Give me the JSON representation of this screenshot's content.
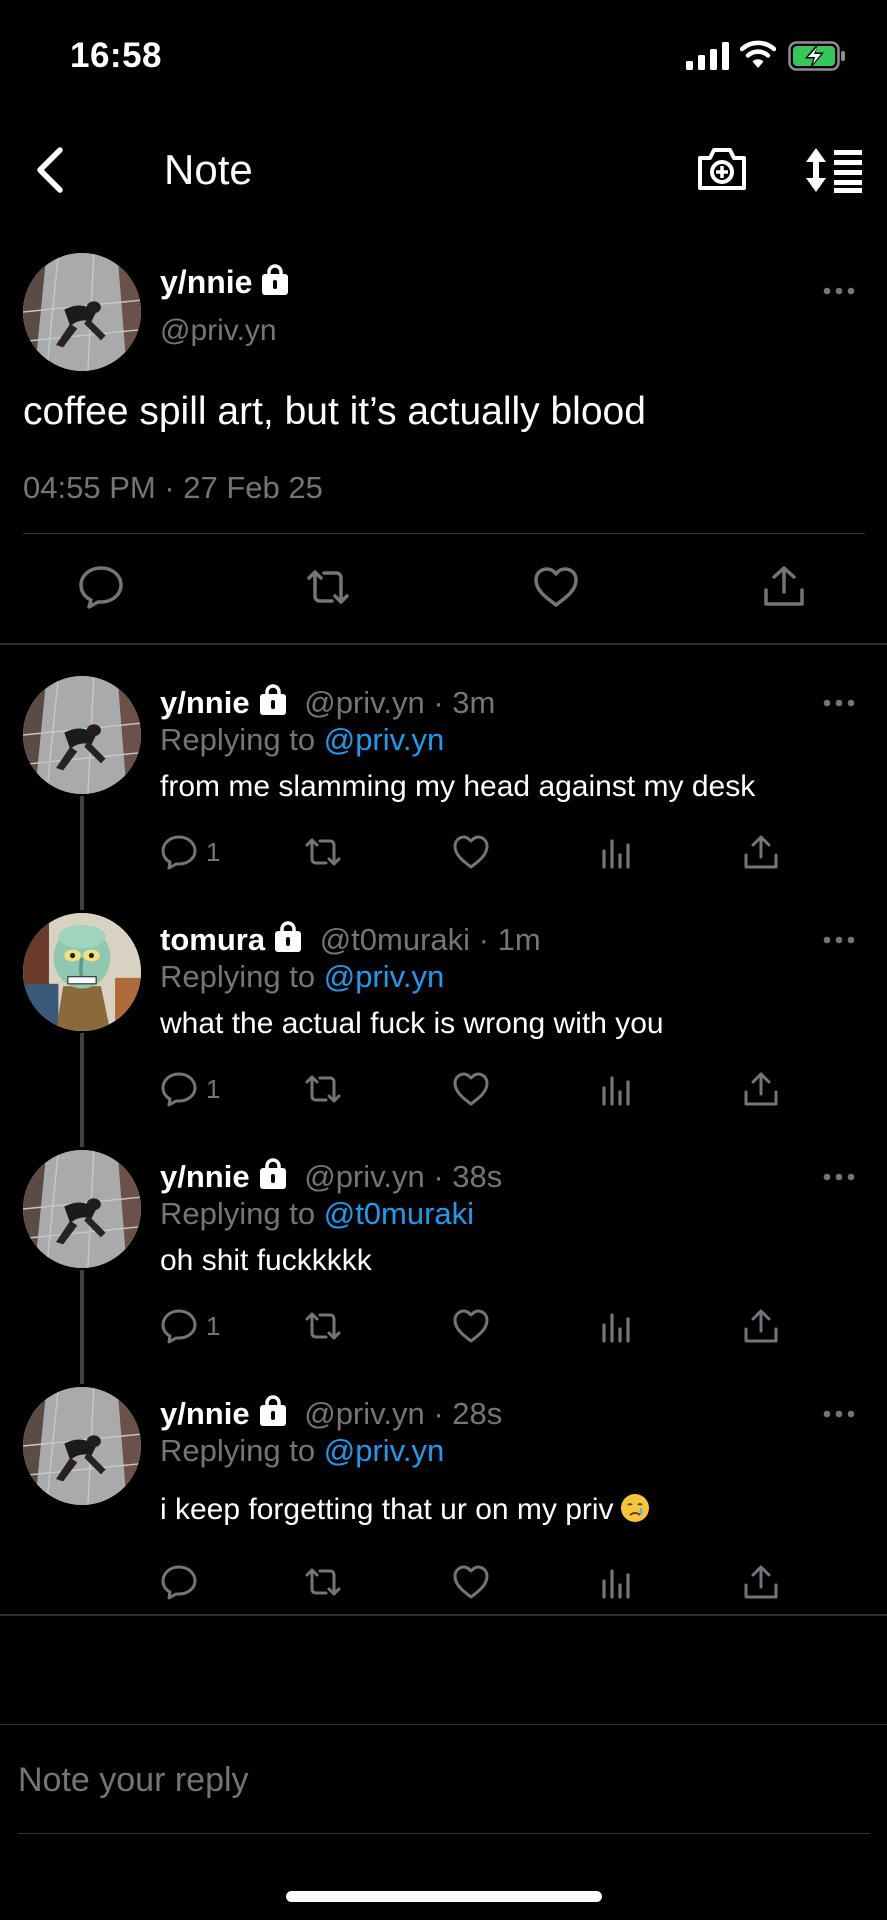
{
  "status_bar": {
    "time": "16:58"
  },
  "nav": {
    "title": "Note",
    "back_icon": "chevron-left-icon",
    "camera_icon": "camera-add-icon",
    "sort_icon": "sort-icon"
  },
  "main_post": {
    "name": "y/nnie",
    "handle": "@priv.yn",
    "text": "coffee spill art, but it’s actually blood",
    "timestamp": "04:55 PM · 27 Feb 25"
  },
  "replies": [
    {
      "name": "y/nnie",
      "handle": "@priv.yn",
      "dot": " · ",
      "time": "3m",
      "replying_prefix": "Replying to ",
      "replying_to": "@priv.yn",
      "text": "from me slamming my head against my desk",
      "reply_count": "1"
    },
    {
      "name": "tomura",
      "handle": "@t0muraki",
      "dot": " · ",
      "time": "1m",
      "replying_prefix": "Replying to ",
      "replying_to": "@priv.yn",
      "text": "what the actual fuck is wrong with you",
      "reply_count": "1"
    },
    {
      "name": "y/nnie",
      "handle": "@priv.yn",
      "dot": " · ",
      "time": "38s",
      "replying_prefix": "Replying to ",
      "replying_to": "@t0muraki",
      "text": "oh shit fuckkkkk",
      "reply_count": "1"
    },
    {
      "name": "y/nnie",
      "handle": "@priv.yn",
      "dot": " · ",
      "time": "28s",
      "replying_prefix": "Replying to ",
      "replying_to": "@priv.yn",
      "text": "i keep forgetting that ur on my priv",
      "reply_count": ""
    }
  ],
  "compose": {
    "placeholder": "Note your reply"
  },
  "colors": {
    "background": "#000000",
    "muted": "#71767b",
    "link": "#1d9bf0",
    "divider": "#2f3336"
  }
}
